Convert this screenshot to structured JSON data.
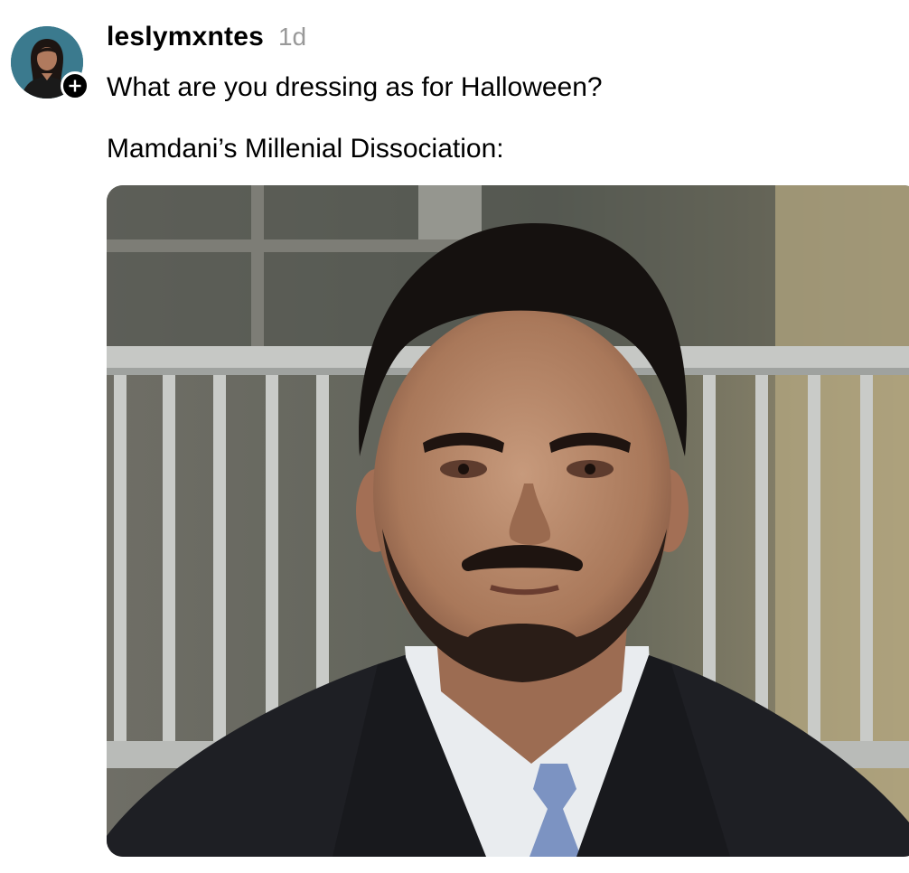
{
  "post": {
    "username": "leslymxntes",
    "timestamp": "1d",
    "text_line_1": "What are you dressing as for Halloween?",
    "text_line_2": "Mamdani’s Millenial Dissociation:"
  },
  "icons": {
    "avatar": "profile-photo",
    "follow": "plus-icon",
    "image": "photo-man-in-suit"
  },
  "colors": {
    "text": "#000000",
    "timestamp": "#999999",
    "badge": "#000000"
  }
}
